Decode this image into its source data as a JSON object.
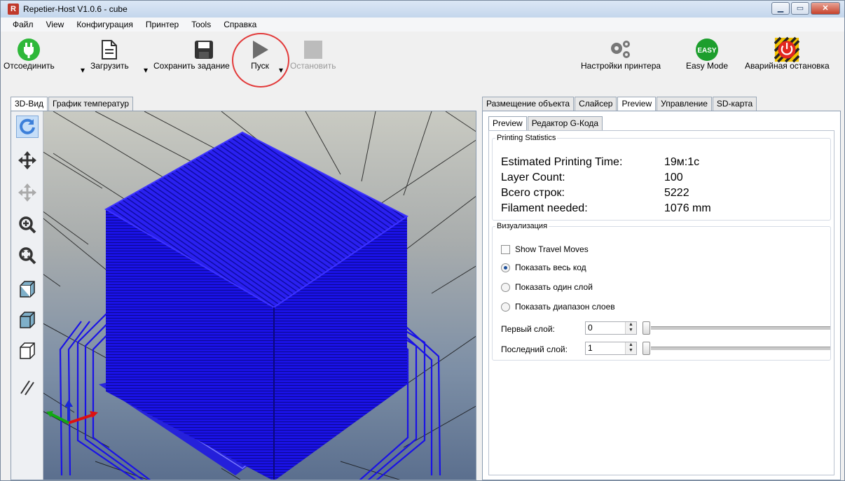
{
  "window": {
    "title": "Repetier-Host V1.0.6 - cube",
    "app_icon_letter": "R"
  },
  "menu": [
    "Файл",
    "View",
    "Конфигурация",
    "Принтер",
    "Tools",
    "Справка"
  ],
  "toolbar": {
    "disconnect": "Отсоединить",
    "load": "Загрузить",
    "save_job": "Сохранить задание",
    "run": "Пуск",
    "stop": "Остановить",
    "printer_settings": "Настройки принтера",
    "easy_mode": "Easy Mode",
    "easy_badge": "EASY",
    "emergency_stop": "Аварийная остановка"
  },
  "left_tabs": [
    "3D-Вид",
    "График температур"
  ],
  "right_tabs": [
    "Размещение объекта",
    "Слайсер",
    "Preview",
    "Управление",
    "SD-карта"
  ],
  "inner_tabs": [
    "Preview",
    "Редактор G-Кода"
  ],
  "stats": {
    "title": "Printing Statistics",
    "rows": [
      {
        "label": "Estimated Printing Time:",
        "value": "19м:1с"
      },
      {
        "label": "Layer Count:",
        "value": "100"
      },
      {
        "label": "Всего строк:",
        "value": "5222"
      },
      {
        "label": "Filament needed:",
        "value": "1076 mm"
      }
    ]
  },
  "visualization": {
    "title": "Визуализация",
    "show_travel": "Show Travel Moves",
    "show_travel_checked": false,
    "radios": [
      "Показать весь код",
      "Показать один слой",
      "Показать диапазон слоев"
    ],
    "selected_radio": 0,
    "first_layer_label": "Первый слой:",
    "first_layer_value": "0",
    "last_layer_label": "Последний слой:",
    "last_layer_value": "1"
  },
  "colors": {
    "model": "#1a12e6",
    "accent": "#3c7fd9",
    "disconnect": "#2fb83a",
    "easy": "#1d9e2d",
    "estop": "#e2271f"
  }
}
